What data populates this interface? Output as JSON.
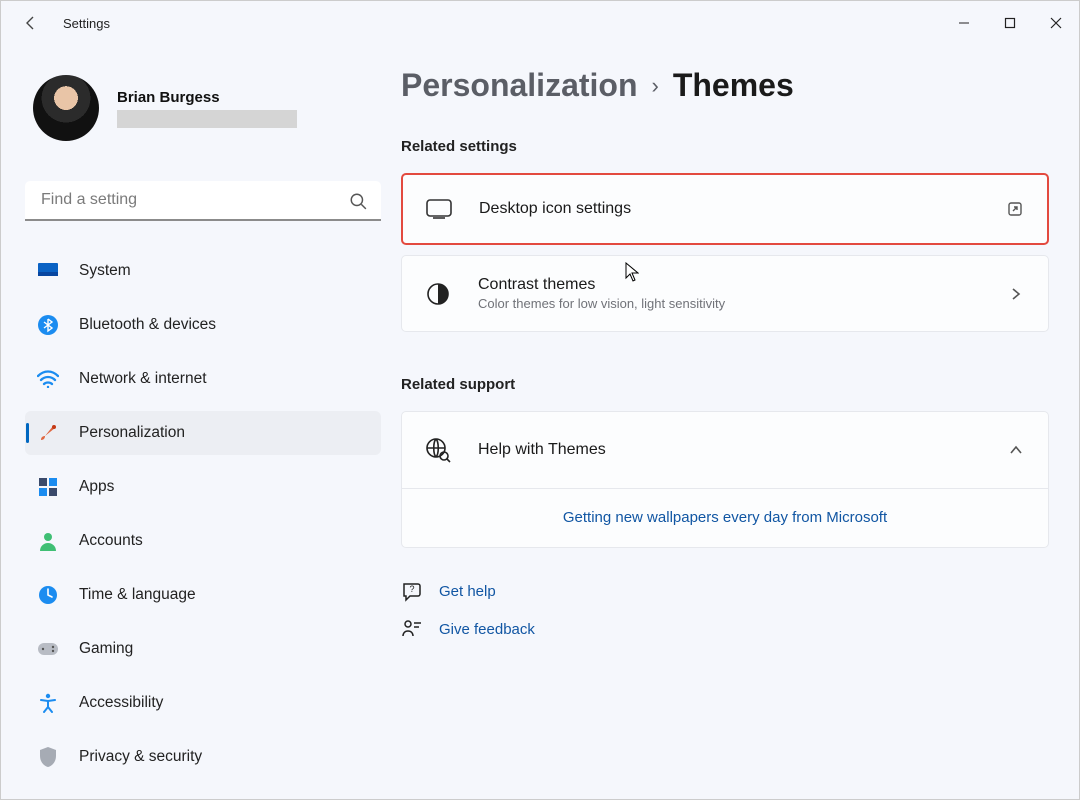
{
  "app_title": "Settings",
  "profile": {
    "name": "Brian Burgess"
  },
  "search": {
    "placeholder": "Find a setting"
  },
  "nav": [
    {
      "label": "System"
    },
    {
      "label": "Bluetooth & devices"
    },
    {
      "label": "Network & internet"
    },
    {
      "label": "Personalization"
    },
    {
      "label": "Apps"
    },
    {
      "label": "Accounts"
    },
    {
      "label": "Time & language"
    },
    {
      "label": "Gaming"
    },
    {
      "label": "Accessibility"
    },
    {
      "label": "Privacy & security"
    }
  ],
  "breadcrumb": {
    "parent": "Personalization",
    "sep": "›",
    "current": "Themes"
  },
  "sections": {
    "related_settings_label": "Related settings",
    "related_support_label": "Related support"
  },
  "cards": {
    "desktop_icons": {
      "title": "Desktop icon settings"
    },
    "contrast": {
      "title": "Contrast themes",
      "sub": "Color themes for low vision, light sensitivity"
    }
  },
  "support": {
    "title": "Help with Themes",
    "link": "Getting new wallpapers every day from Microsoft"
  },
  "help_links": {
    "get_help": "Get help",
    "feedback": "Give feedback"
  }
}
